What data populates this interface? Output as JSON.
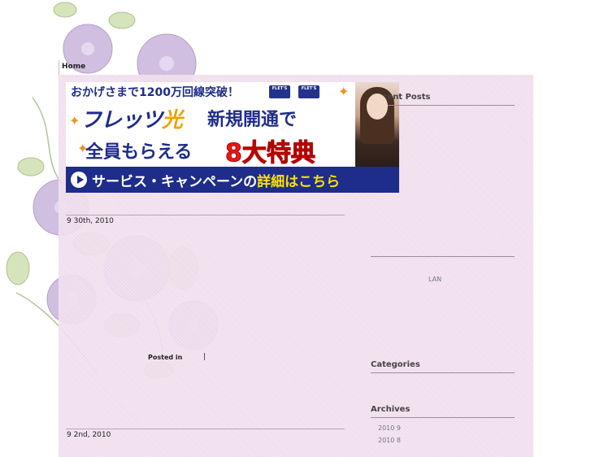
{
  "nav": {
    "home": "Home"
  },
  "banner": {
    "headline": "おかげさまで1200万回線突破！",
    "logo1": "FLET'S",
    "logo2": "FLET'S",
    "brand": "フレッツ",
    "brand_hikari": "光",
    "tagline1": "新規開通で",
    "tagline2": "全員もらえる",
    "tagline3": "8大特典",
    "cta_text": "サービス・キャンペーンの",
    "cta_highlight": "詳細はこちら"
  },
  "posts": [
    {
      "date": "9  30th, 2010"
    },
    {
      "date": "9  2nd, 2010"
    }
  ],
  "post_meta": {
    "posted_in": "Posted in",
    "separator": "|"
  },
  "sidebar": {
    "recent_posts": "Recent Posts",
    "recent_link": "LAN",
    "categories": "Categories",
    "archives": "Archives",
    "archive_items": [
      "2010  9",
      "2010  8"
    ]
  },
  "colors": {
    "panel": "#efdcec",
    "banner_blue": "#1e2c8a",
    "banner_red": "#e81818"
  }
}
